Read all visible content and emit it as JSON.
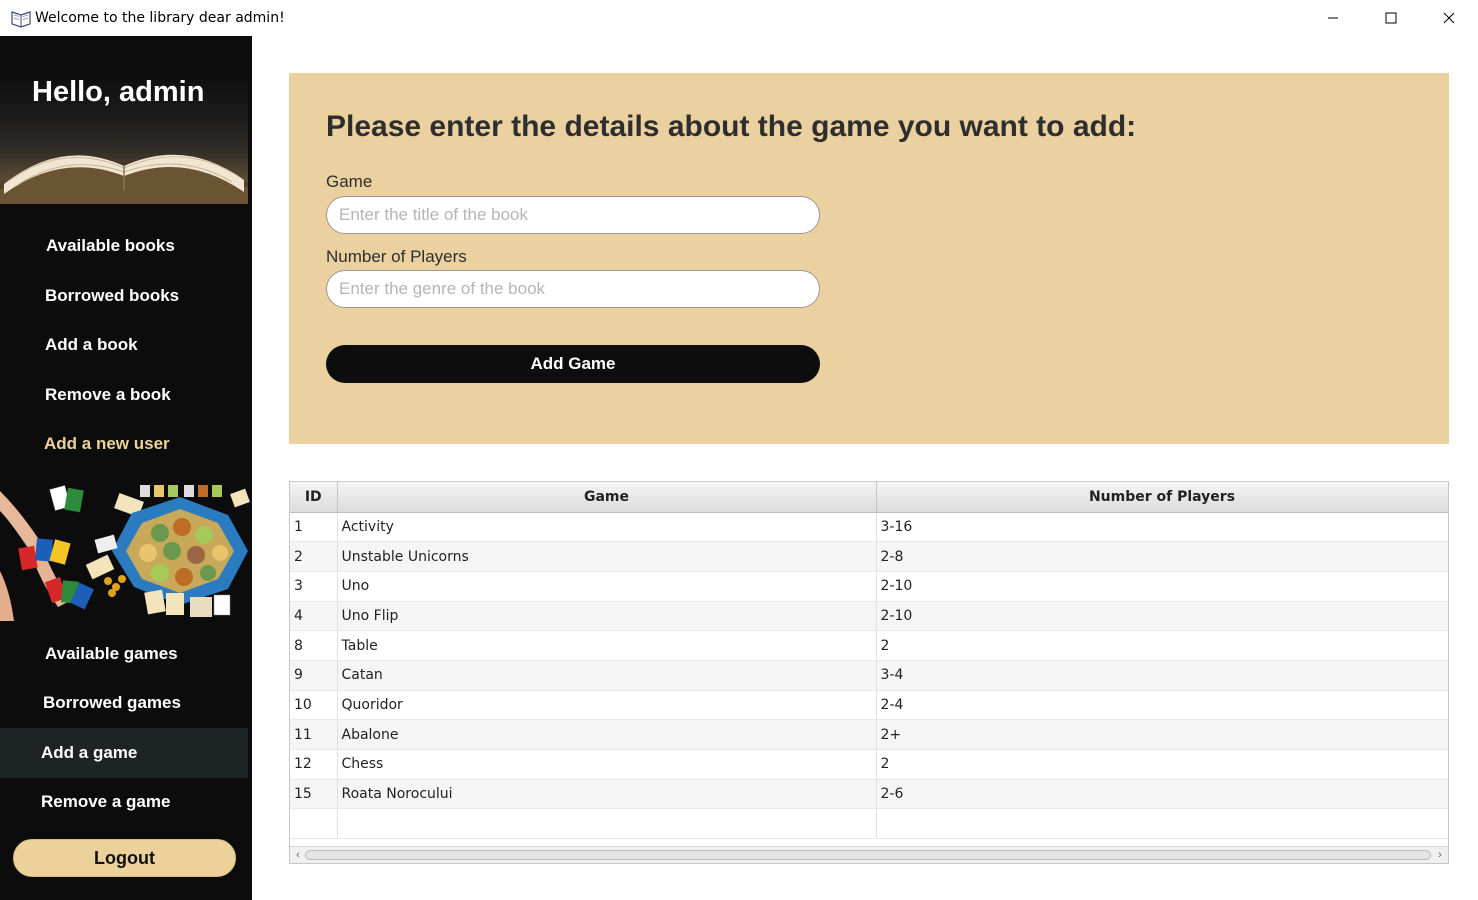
{
  "window": {
    "title": "Welcome to the library dear admin!",
    "controls": [
      "minimize-icon",
      "maximize-icon",
      "close-icon"
    ]
  },
  "sidebar": {
    "greeting": "Hello, admin",
    "book_items": [
      {
        "label": "Available books",
        "accent": false
      },
      {
        "label": "Borrowed books",
        "accent": false
      },
      {
        "label": "Add a book",
        "accent": false
      },
      {
        "label": "Remove a book",
        "accent": false
      },
      {
        "label": "Add a new user",
        "accent": true
      }
    ],
    "game_items": [
      {
        "label": "Available games",
        "active": false
      },
      {
        "label": "Borrowed games",
        "active": false
      },
      {
        "label": "Add a game",
        "active": true
      },
      {
        "label": "Remove a game",
        "active": false
      }
    ],
    "logout_label": "Logout"
  },
  "form": {
    "heading": "Please enter the details about the game you want to add:",
    "game_label": "Game",
    "game_placeholder": "Enter the title of the book",
    "players_label": "Number of Players",
    "players_placeholder": "Enter the genre of the book",
    "submit_label": "Add Game"
  },
  "table": {
    "columns": [
      "ID",
      "Game",
      "Number of Players"
    ],
    "rows": [
      [
        "1",
        "Activity",
        "3-16"
      ],
      [
        "2",
        "Unstable Unicorns",
        "2-8"
      ],
      [
        "3",
        "Uno",
        "2-10"
      ],
      [
        "4",
        "Uno Flip",
        "2-10"
      ],
      [
        "8",
        "Table",
        "2"
      ],
      [
        "9",
        "Catan",
        "3-4"
      ],
      [
        "10",
        "Quoridor",
        "2-4"
      ],
      [
        "11",
        "Abalone",
        "2+"
      ],
      [
        "12",
        "Chess",
        "2"
      ],
      [
        "15",
        "Roata Norocului",
        "2-6"
      ]
    ]
  },
  "colors": {
    "sidebar_bg": "#0c0c0c",
    "accent": "#ecd19b",
    "panel_bg": "#ead19f",
    "active_item_bg": "#1e2326",
    "button_dark": "#0d0d0d"
  }
}
